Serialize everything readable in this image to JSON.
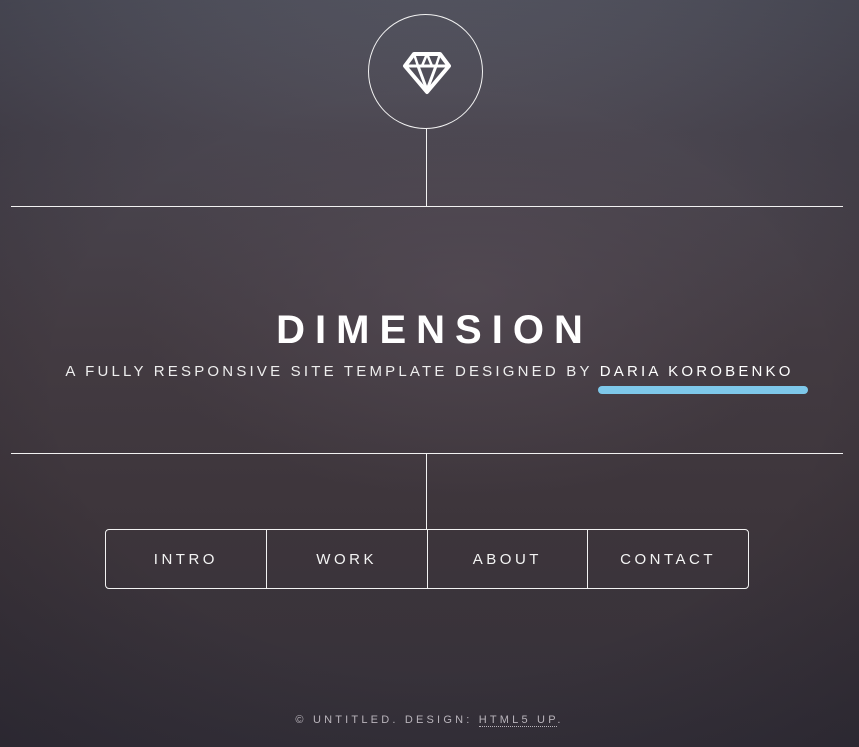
{
  "header": {
    "logo_icon": "diamond-icon",
    "title": "DIMENSION",
    "subtitle_prefix": "A FULLY RESPONSIVE SITE TEMPLATE DESIGNED BY ",
    "subtitle_link": "DARIA KOROBENKO",
    "link_highlight_color": "#7ec8ea"
  },
  "nav": {
    "items": [
      {
        "label": "INTRO"
      },
      {
        "label": "WORK"
      },
      {
        "label": "ABOUT"
      },
      {
        "label": "CONTACT"
      }
    ]
  },
  "footer": {
    "prefix": "© UNTITLED. DESIGN: ",
    "link": "HTML5 UP",
    "suffix": "."
  }
}
